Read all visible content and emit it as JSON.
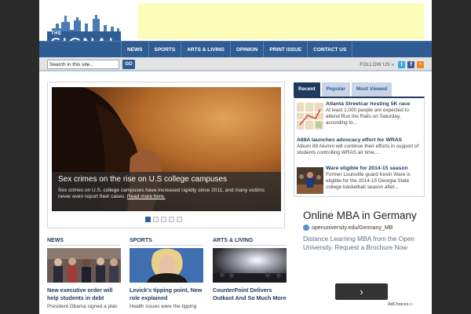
{
  "site": {
    "logo_small": "THE",
    "logo_big": "SIGNAL"
  },
  "nav": {
    "items": [
      "NEWS",
      "SPORTS",
      "ARTS & LIVING",
      "OPINION",
      "PRINT ISSUE",
      "CONTACT US"
    ]
  },
  "search": {
    "value": "Search in this site...",
    "go_label": "GO"
  },
  "follow": {
    "label": "FOLLOW US »",
    "icons": [
      "twitter-icon",
      "facebook-icon",
      "rss-icon"
    ]
  },
  "slider": {
    "title": "Sex crimes on the rise on U.S college campuses",
    "text": "Sex crimes on U.S. college campuses have increased rapidly since 2011, and many victims never even report their cases.",
    "more": "Read more here."
  },
  "tabs": [
    "Recent",
    "Popular",
    "Most Viewed"
  ],
  "recent": [
    {
      "title": "Atlanta Streetcar hosting 5K race",
      "text": "At least 1,000 people are expected to attend Run the Rails on Saturday, according to..."
    },
    {
      "title": "A88A launches advocacy effort for WRAS",
      "text": "Album 88 Alumni will continue their efforts in support of students controlling WRAS air time,..."
    },
    {
      "title": "Ware eligible for 2014-15 season",
      "text": "Former Louisville guard Kevin Ware is eligible for the 2014-15 Georgia State college basketball season after..."
    }
  ],
  "categories": [
    {
      "heading": "NEWS",
      "title": "New executive order will help students in debt",
      "text": "President Obama signed a plan"
    },
    {
      "heading": "SPORTS",
      "title": "Levick's tipping point, New role explained",
      "text": "Health issues were the tipping"
    },
    {
      "heading": "ARTS & LIVING",
      "title": "CounterPoint Delivers Outkast And So Much More",
      "text": ""
    }
  ],
  "ad": {
    "title": "Online MBA in Germany",
    "url": "openuniversity.edu/Germany_MB",
    "desc": "Distance Learning MBA from the Open University. Request a Brochure Now",
    "cta": "›",
    "adchoices": "AdChoices ▷"
  },
  "colors": {
    "nav_bg": "#2f5d93",
    "dark_blue": "#1f3a5f",
    "ad_yellow": "#fcfdb8"
  }
}
